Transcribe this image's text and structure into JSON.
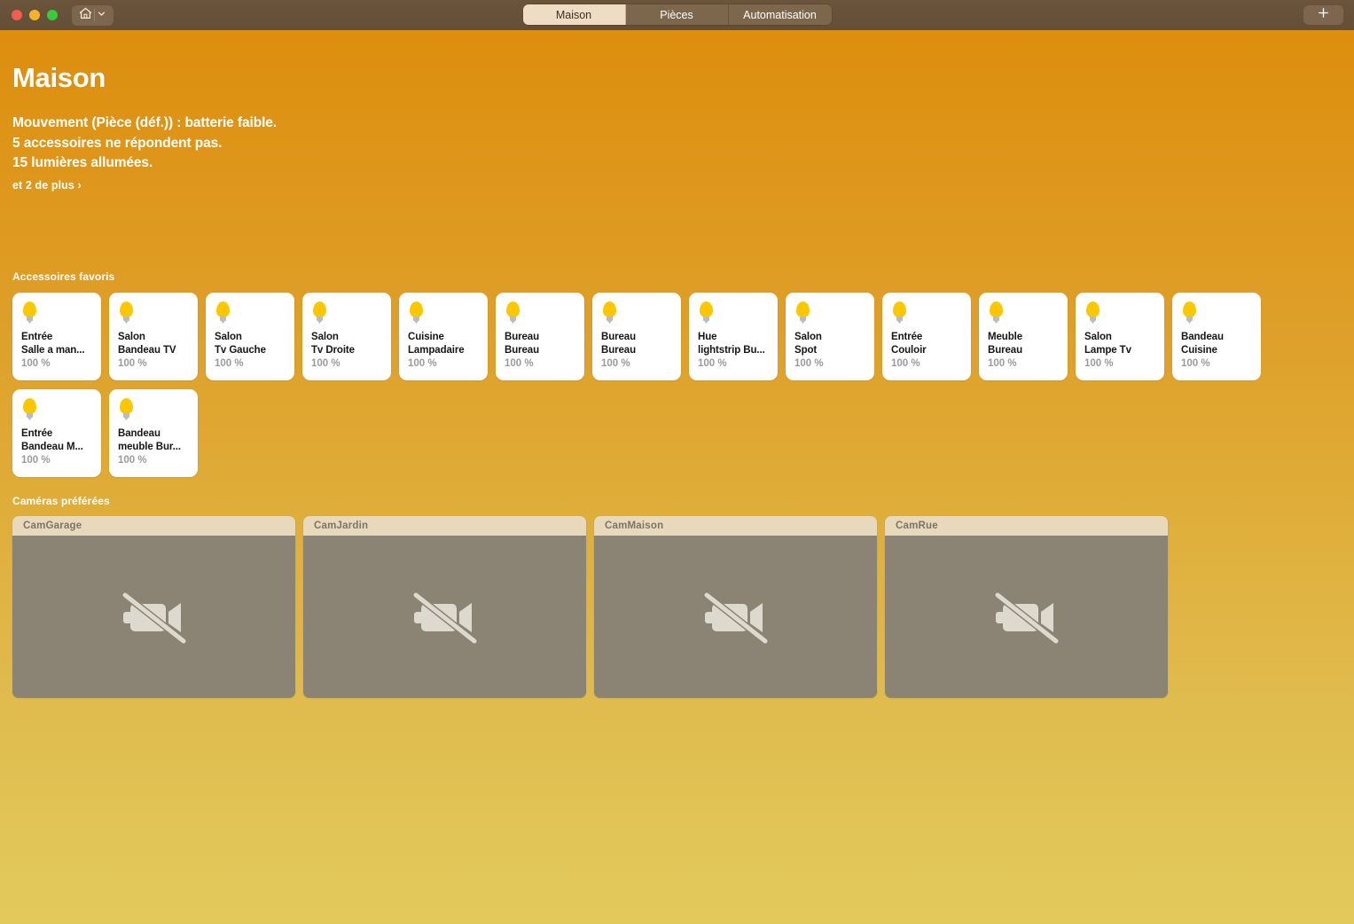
{
  "window": {
    "traffic_lights": [
      "close-button",
      "minimize-button",
      "zoom-button"
    ],
    "home_button_icon": "house-icon",
    "home_button_chevron": "chevron-down-icon",
    "add_button_label": "+",
    "colors": {
      "titlebar": "#644e36",
      "bg_top": "#dd8c0a",
      "bg_bottom": "#e2c95c",
      "tab_active_bg": "#eedcc4",
      "tab_inactive_bg": "#7c664c",
      "bulb_yellow": "#fdc700",
      "camera_tile": "#8b8374",
      "camera_label_bg": "#e9d9bc"
    }
  },
  "tabs": [
    {
      "label": "Maison",
      "active": true
    },
    {
      "label": "Pièces",
      "active": false
    },
    {
      "label": "Automatisation",
      "active": false
    }
  ],
  "header": {
    "title": "Maison",
    "status_lines": [
      "Mouvement (Pièce (déf.)) : batterie faible.",
      "5 accessoires ne répondent pas.",
      "15 lumières allumées."
    ],
    "more_link": "et 2 de plus ›"
  },
  "favorites": {
    "section_title": "Accessoires favoris",
    "items": [
      {
        "line1": "Entrée",
        "line2": "Salle a man...",
        "state": "100 %",
        "icon": "lightbulb-icon"
      },
      {
        "line1": "Salon",
        "line2": "Bandeau TV",
        "state": "100 %",
        "icon": "lightbulb-icon"
      },
      {
        "line1": "Salon",
        "line2": "Tv Gauche",
        "state": "100 %",
        "icon": "lightbulb-icon"
      },
      {
        "line1": "Salon",
        "line2": "Tv Droite",
        "state": "100 %",
        "icon": "lightbulb-icon"
      },
      {
        "line1": "Cuisine",
        "line2": "Lampadaire",
        "state": "100 %",
        "icon": "lightbulb-icon"
      },
      {
        "line1": "Bureau",
        "line2": "Bureau",
        "state": "100 %",
        "icon": "lightbulb-icon"
      },
      {
        "line1": "Bureau",
        "line2": "Bureau",
        "state": "100 %",
        "icon": "lightbulb-icon"
      },
      {
        "line1": "Hue",
        "line2": "lightstrip Bu...",
        "state": "100 %",
        "icon": "lightbulb-icon"
      },
      {
        "line1": "Salon",
        "line2": "Spot",
        "state": "100 %",
        "icon": "lightbulb-icon"
      },
      {
        "line1": "Entrée",
        "line2": "Couloir",
        "state": "100 %",
        "icon": "lightbulb-icon"
      },
      {
        "line1": "Meuble",
        "line2": "Bureau",
        "state": "100 %",
        "icon": "lightbulb-icon"
      },
      {
        "line1": "Salon",
        "line2": "Lampe Tv",
        "state": "100 %",
        "icon": "lightbulb-icon"
      },
      {
        "line1": "Bandeau",
        "line2": "Cuisine",
        "state": "100 %",
        "icon": "lightbulb-icon"
      },
      {
        "line1": "Entrée",
        "line2": "Bandeau M...",
        "state": "100 %",
        "icon": "lightbulb-icon"
      },
      {
        "line1": "Bandeau",
        "line2": "meuble Bur...",
        "state": "100 %",
        "icon": "lightbulb-icon"
      }
    ]
  },
  "cameras": {
    "section_title": "Caméras préférées",
    "items": [
      {
        "label": "CamGarage",
        "icon": "video-off-icon"
      },
      {
        "label": "CamJardin",
        "icon": "video-off-icon"
      },
      {
        "label": "CamMaison",
        "icon": "video-off-icon"
      },
      {
        "label": "CamRue",
        "icon": "video-off-icon"
      }
    ]
  }
}
